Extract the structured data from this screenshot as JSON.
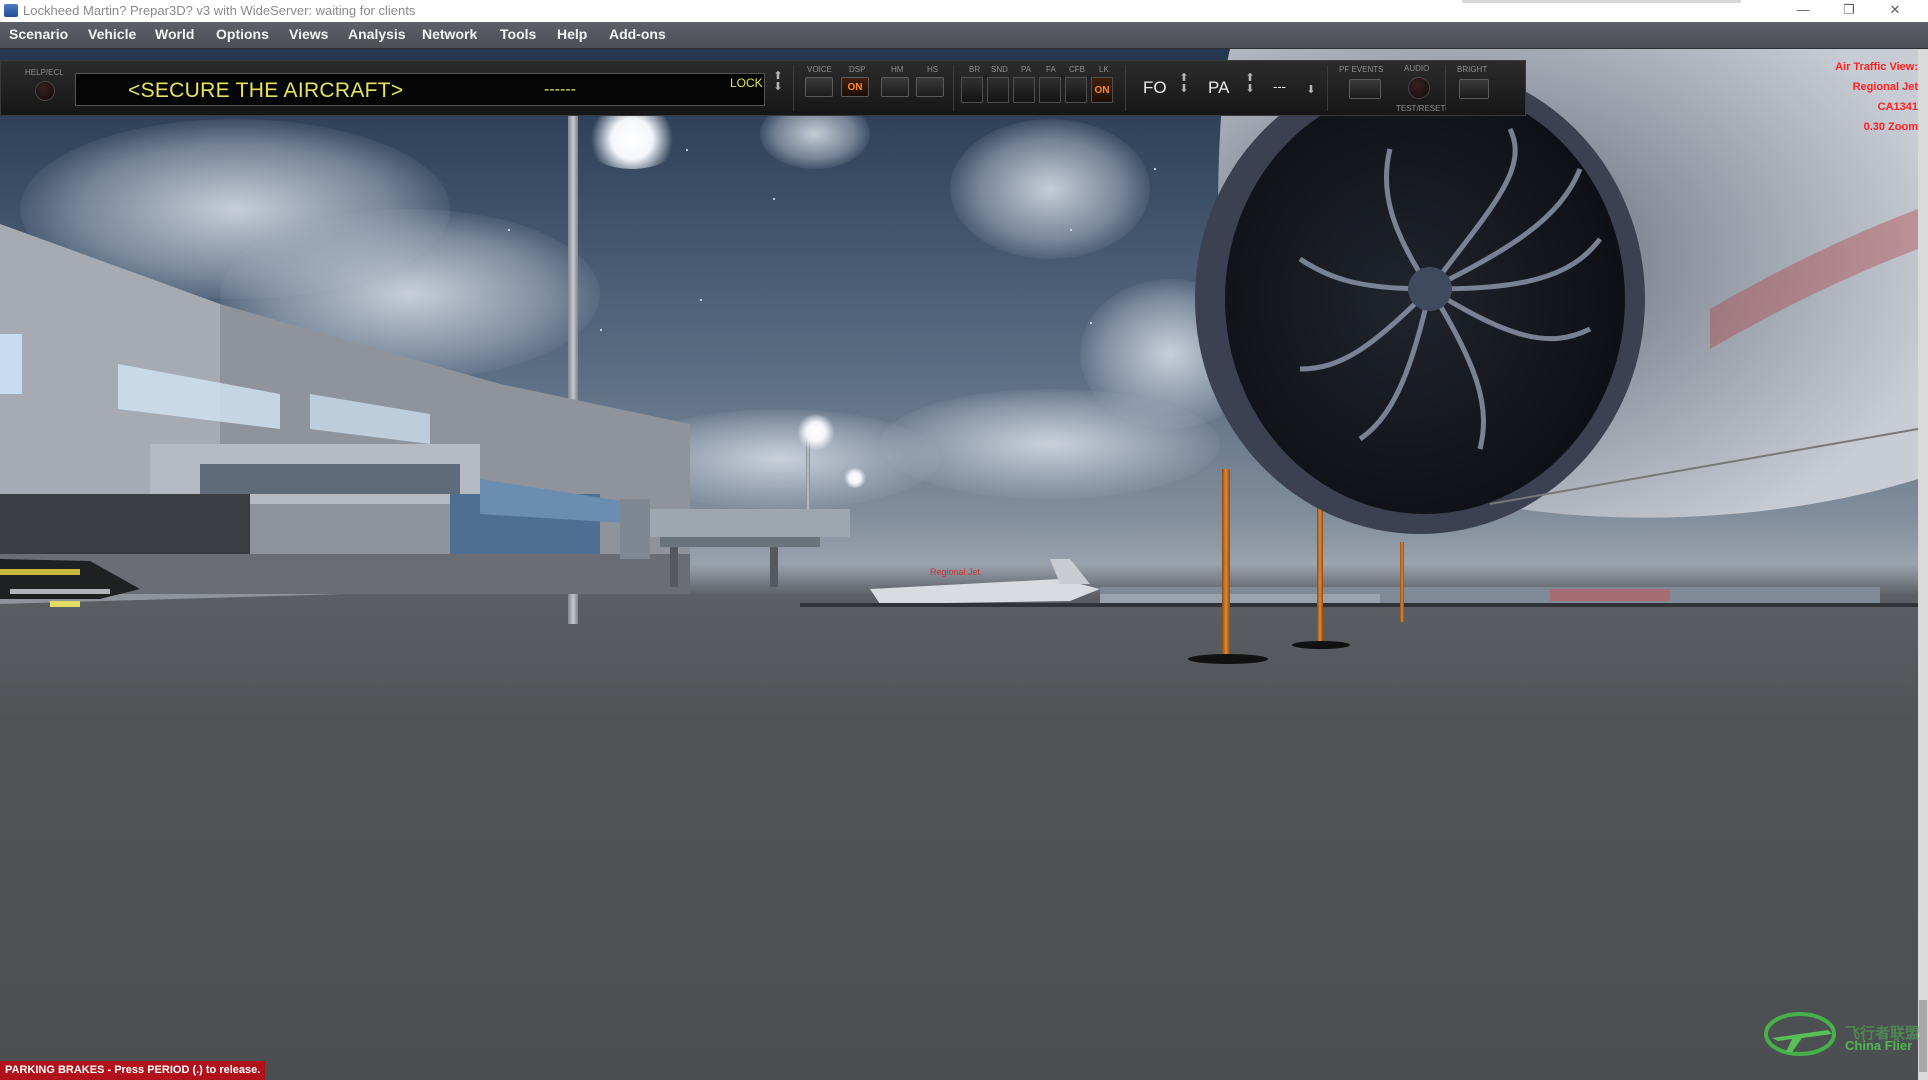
{
  "window": {
    "title": "Lockheed Martin? Prepar3D? v3 with WideServer: waiting for clients",
    "controls": {
      "minimize": "—",
      "restore": "❐",
      "close": "✕"
    }
  },
  "menu": {
    "items": [
      "Scenario",
      "Vehicle",
      "World",
      "Options",
      "Views",
      "Analysis",
      "Network",
      "Tools",
      "Help",
      "Add-ons"
    ]
  },
  "panel": {
    "help_label": "HELP/ECL",
    "message": "<SECURE THE AIRCRAFT>",
    "message_value": "------",
    "lock_label": "LOCK",
    "voice_label": "VOICE",
    "dsp_label": "DSP",
    "dsp_state": "ON",
    "hm_label": "HM",
    "hs_label": "HS",
    "br_label": "BR",
    "snd_label": "SND",
    "pa_small_label": "PA",
    "fa_label": "FA",
    "cfb_label": "CFB",
    "lk_label": "LK",
    "lk_state": "ON",
    "fo_label": "FO",
    "pa_label": "PA",
    "pa_value": "---",
    "pf_events_label": "PF EVENTS",
    "audio_label": "AUDIO",
    "test_reset_label": "TEST/RESET",
    "bright_label": "BRIGHT",
    "arrow_up": "⬆",
    "arrow_down": "⬇"
  },
  "atc_view": {
    "title": "Air Traffic View:",
    "aircraft": "Regional Jet",
    "callsign": "CA1341",
    "zoom": "0.30 Zoom"
  },
  "scene": {
    "aircraft_label": "Regional Jet"
  },
  "status": {
    "parking_brakes": "PARKING BRAKES - Press PERIOD (.) to release."
  },
  "watermark": {
    "cn": "飞行者联盟",
    "en": "China Flier"
  },
  "colors": {
    "atc_red": "#ff2020",
    "display_yellow": "#e6e35c",
    "on_orange": "#ff8a2a",
    "status_red": "#b0111b"
  }
}
